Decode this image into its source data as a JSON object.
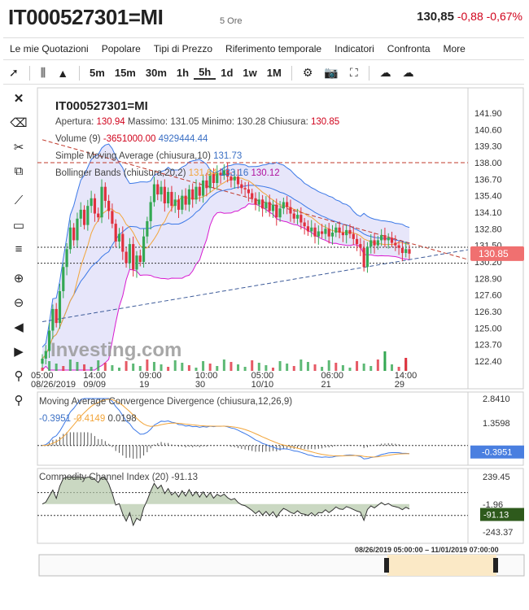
{
  "header": {
    "symbol": "IT000527301=MI",
    "period": "5 Ore",
    "price": "130,85",
    "change": "-0,88 -0,67%"
  },
  "menu": [
    "Le mie Quotazioni",
    "Popolare",
    "Tipi di Prezzo",
    "Riferimento temporale",
    "Indicatori",
    "Confronta",
    "More"
  ],
  "toolbar": {
    "intervals": [
      "5m",
      "15m",
      "30m",
      "1h",
      "5h",
      "1d",
      "1w",
      "1M"
    ],
    "active_interval": "5h"
  },
  "legend": {
    "symbol": "IT000527301=MI",
    "apertura_label": "Apertura:",
    "apertura": "130.94",
    "massimo_label": "Massimo:",
    "massimo": "131.05",
    "minimo_label": "Minimo:",
    "minimo": "130.28",
    "chiusura_label": "Chiusura:",
    "chiusura": "130.85",
    "volume_label": "Volume (9)",
    "volume_a": "-3651000.00",
    "volume_b": "4929444.44",
    "sma_label": "Simple Moving Average (chiusura,10)",
    "sma_value": "131.73",
    "bb_label": "Bollinger Bands (chiusura,20,2)",
    "bb_mid": "131.64",
    "bb_up": "133.16",
    "bb_low": "130.12",
    "macd_label": "Moving Average Convergence Divergence (chiusura,12,26,9)",
    "macd_a": "-0.3951",
    "macd_b": "-0.4149",
    "macd_c": "0.0198",
    "cci_label": "Commodity Channel Index (20)",
    "cci_value": "-91.13"
  },
  "colors": {
    "up": "#34a853",
    "down": "#e0303e",
    "bb_fill": "#c9c8f3",
    "bb_band": "#3b78e7",
    "bb_low_line": "#d81bd0",
    "sma": "#f2a53a",
    "trend_red": "#c0392b",
    "trend_blue": "#3e5c9a",
    "price_tag": "#f07070",
    "macd_tag": "#4a7fe0",
    "cci_tag": "#2e5a1c",
    "cci_fill": "#b3c7a8"
  },
  "price_axis_labels": [
    "141.90",
    "140.60",
    "139.30",
    "138.00",
    "136.70",
    "135.40",
    "134.10",
    "132.80",
    "131.50",
    "130.20",
    "128.90",
    "127.60",
    "126.30",
    "125.00",
    "123.70",
    "122.40"
  ],
  "time_axis": [
    {
      "t": "05:00",
      "d": "08/26/2019"
    },
    {
      "t": "14:00",
      "d": "09/09"
    },
    {
      "t": "09:00",
      "d": "19"
    },
    {
      "t": "10:00",
      "d": "30"
    },
    {
      "t": "05:00",
      "d": "10/10"
    },
    {
      "t": "06:00",
      "d": "21"
    },
    {
      "t": "14:00",
      "d": "29"
    }
  ],
  "macd_axis_labels": [
    "2.8410",
    "1.3598",
    "-0.3951"
  ],
  "cci_axis_labels": [
    "239.45",
    "-1.96",
    "-91.13",
    "-243.37"
  ],
  "price_tag": "130.85",
  "navigator_range": "08/26/2019 05:00:00 – 11/01/2019 07:00:00",
  "watermark": "Investing.com",
  "chart_data": {
    "type": "candlestick",
    "title": "IT000527301=MI",
    "ylim": [
      121.7,
      142.6
    ],
    "y_ticks": [
      141.9,
      140.6,
      139.3,
      138.0,
      136.7,
      135.4,
      134.1,
      132.8,
      131.5,
      130.2,
      128.9,
      127.6,
      126.3,
      125.0,
      123.7,
      122.4
    ],
    "x_tick_labels": [
      "05:00 08/26/2019",
      "14:00 09/09",
      "09:00 19",
      "10:00 30",
      "05:00 10/10",
      "06:00 21",
      "14:00 29"
    ],
    "closes": [
      122.6,
      123.2,
      124.8,
      126.5,
      125.4,
      127.9,
      129.8,
      131.2,
      132.9,
      131.9,
      133.6,
      134.3,
      133.1,
      134.6,
      135.2,
      134.0,
      133.7,
      136.1,
      135.0,
      134.2,
      133.2,
      131.8,
      132.4,
      131.0,
      130.1,
      131.6,
      129.6,
      130.7,
      130.2,
      132.2,
      133.4,
      134.9,
      136.3,
      135.5,
      136.1,
      134.8,
      135.7,
      134.6,
      135.1,
      134.3,
      135.4,
      134.7,
      135.9,
      135.1,
      136.1,
      135.4,
      136.6,
      136.0,
      137.1,
      136.4,
      137.2,
      137.0,
      137.4,
      136.9,
      136.6,
      136.9,
      136.3,
      136.0,
      135.9,
      135.6,
      135.2,
      134.7,
      135.1,
      134.4,
      134.9,
      134.2,
      134.7,
      133.7,
      134.4,
      134.9,
      134.5,
      134.0,
      133.6,
      133.9,
      133.3,
      133.0,
      132.6,
      132.9,
      132.2,
      132.6,
      132.4,
      132.8,
      132.2,
      132.5,
      132.9,
      132.5,
      132.3,
      132.7,
      132.4,
      132.0,
      131.6,
      131.3,
      129.8,
      131.4,
      131.9,
      131.5,
      131.9,
      132.3,
      131.9,
      132.1,
      131.7,
      131.5,
      131.3,
      130.9,
      131.2,
      130.85
    ],
    "trendlines": [
      {
        "name": "",
        "from": [
          0,
          139.8
        ],
        "to": [
          106,
          130.9
        ]
      },
      {
        "name": "",
        "from": [
          0,
          125.5
        ],
        "to": [
          106,
          130.9
        ]
      }
    ],
    "horizontal_levels": [
      138.0,
      131.35,
      130.1
    ],
    "volume": {
      "a": -3651000.0,
      "b": 4929444.44
    },
    "indicators": {
      "sma_10": 131.73,
      "bollinger_20_2": {
        "middle": 131.64,
        "upper": 133.16,
        "lower": 130.12
      },
      "macd_12_26_9": {
        "macd": -0.3951,
        "signal": -0.4149,
        "histogram": 0.0198,
        "ylim": [
          -0.9,
          2.84
        ]
      },
      "cci_20": {
        "value": -91.13,
        "ylim": [
          -243.37,
          239.45
        ]
      }
    }
  }
}
